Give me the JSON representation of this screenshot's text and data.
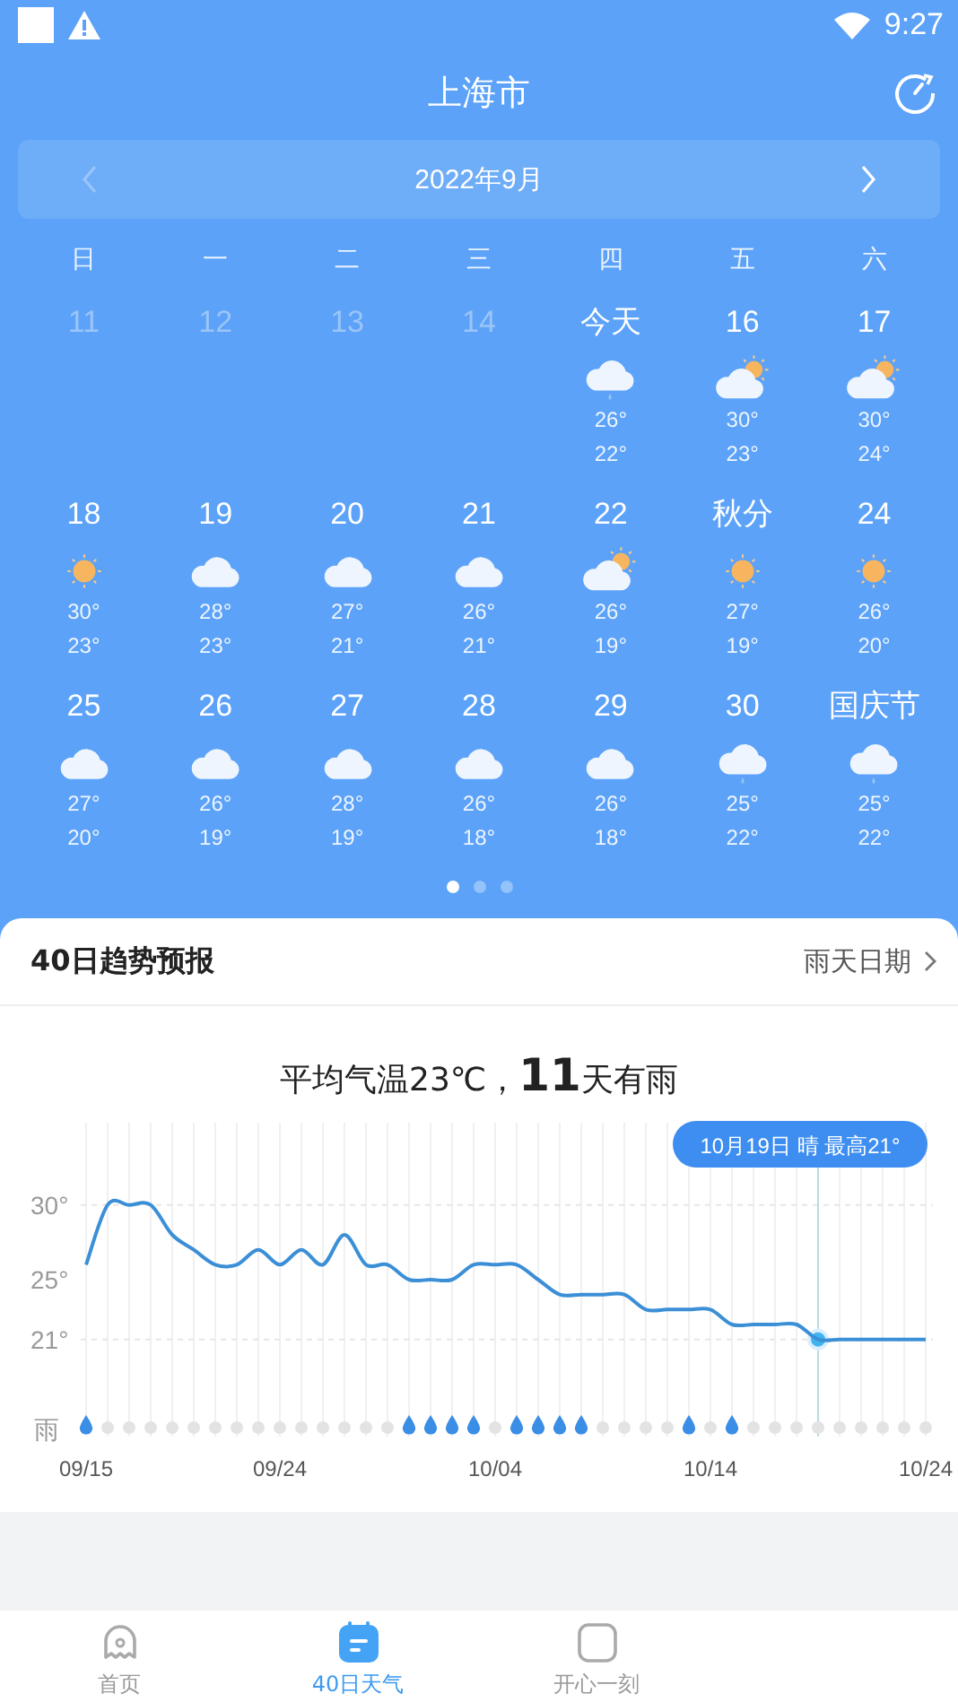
{
  "status_bar": {
    "time": "9:27"
  },
  "header": {
    "title": "上海市"
  },
  "month_nav": {
    "label": "2022年9月",
    "prev": {
      "disabled": true
    },
    "next": {
      "disabled": false
    }
  },
  "calendar": {
    "weekdays": [
      "日",
      "一",
      "二",
      "三",
      "四",
      "五",
      "六"
    ],
    "weeks": [
      [
        {
          "label": "11",
          "past": true,
          "kind": "empty"
        },
        {
          "label": "12",
          "past": true,
          "kind": "empty"
        },
        {
          "label": "13",
          "past": true,
          "kind": "empty"
        },
        {
          "label": "14",
          "past": true,
          "kind": "empty"
        },
        {
          "label": "今天",
          "past": false,
          "kind": "rain",
          "high": "26°",
          "low": "22°"
        },
        {
          "label": "16",
          "past": false,
          "kind": "partly_cloudy",
          "high": "30°",
          "low": "23°"
        },
        {
          "label": "17",
          "past": false,
          "kind": "partly_cloudy",
          "high": "30°",
          "low": "24°"
        }
      ],
      [
        {
          "label": "18",
          "past": false,
          "kind": "sunny",
          "high": "30°",
          "low": "23°"
        },
        {
          "label": "19",
          "past": false,
          "kind": "cloudy",
          "high": "28°",
          "low": "23°"
        },
        {
          "label": "20",
          "past": false,
          "kind": "cloudy",
          "high": "27°",
          "low": "21°"
        },
        {
          "label": "21",
          "past": false,
          "kind": "cloudy",
          "high": "26°",
          "low": "21°"
        },
        {
          "label": "22",
          "past": false,
          "kind": "partly_cloudy",
          "high": "26°",
          "low": "19°"
        },
        {
          "label": "秋分",
          "past": false,
          "kind": "sunny",
          "high": "27°",
          "low": "19°"
        },
        {
          "label": "24",
          "past": false,
          "kind": "sunny",
          "high": "26°",
          "low": "20°"
        }
      ],
      [
        {
          "label": "25",
          "past": false,
          "kind": "cloudy",
          "high": "27°",
          "low": "20°"
        },
        {
          "label": "26",
          "past": false,
          "kind": "cloudy",
          "high": "26°",
          "low": "19°"
        },
        {
          "label": "27",
          "past": false,
          "kind": "cloudy",
          "high": "28°",
          "low": "19°"
        },
        {
          "label": "28",
          "past": false,
          "kind": "cloudy",
          "high": "26°",
          "low": "18°"
        },
        {
          "label": "29",
          "past": false,
          "kind": "cloudy",
          "high": "26°",
          "low": "18°"
        },
        {
          "label": "30",
          "past": false,
          "kind": "rain",
          "high": "25°",
          "low": "22°"
        },
        {
          "label": "国庆节",
          "past": false,
          "kind": "rain",
          "high": "25°",
          "low": "22°"
        }
      ]
    ]
  },
  "pager": [
    {
      "selected": true
    },
    {
      "selected": false
    },
    {
      "selected": false
    }
  ],
  "trend_card": {
    "title": "40日趋势预报",
    "link": "雨天日期",
    "summary": "平均气温23℃，**11**天有雨",
    "chart": {
      "rain_label": "雨",
      "days": [
        {
          "rain": true,
          "selected": false
        },
        {
          "rain": false,
          "selected": false
        },
        {
          "rain": false,
          "selected": false
        },
        {
          "rain": false,
          "selected": false
        },
        {
          "rain": false,
          "selected": false
        },
        {
          "rain": false,
          "selected": false
        },
        {
          "rain": false,
          "selected": false
        },
        {
          "rain": false,
          "selected": false
        },
        {
          "rain": false,
          "selected": false
        },
        {
          "rain": false,
          "selected": false
        },
        {
          "rain": false,
          "selected": false
        },
        {
          "rain": false,
          "selected": false
        },
        {
          "rain": false,
          "selected": false
        },
        {
          "rain": false,
          "selected": false
        },
        {
          "rain": false,
          "selected": false
        },
        {
          "rain": true,
          "selected": false
        },
        {
          "rain": true,
          "selected": false
        },
        {
          "rain": true,
          "selected": false
        },
        {
          "rain": true,
          "selected": false
        },
        {
          "rain": false,
          "selected": false
        },
        {
          "rain": true,
          "selected": false
        },
        {
          "rain": true,
          "selected": false
        },
        {
          "rain": true,
          "selected": false
        },
        {
          "rain": true,
          "selected": false
        },
        {
          "rain": false,
          "selected": false
        },
        {
          "rain": false,
          "selected": false
        },
        {
          "rain": false,
          "selected": false
        },
        {
          "rain": false,
          "selected": false
        },
        {
          "rain": true,
          "selected": false
        },
        {
          "rain": false,
          "selected": false
        },
        {
          "rain": true,
          "selected": false
        },
        {
          "rain": false,
          "selected": false
        },
        {
          "rain": false,
          "selected": false
        },
        {
          "rain": false,
          "selected": false
        },
        {
          "rain": false,
          "selected": true
        },
        {
          "rain": false,
          "selected": false
        },
        {
          "rain": false,
          "selected": false
        },
        {
          "rain": false,
          "selected": false
        },
        {
          "rain": false,
          "selected": false
        },
        {
          "rain": false,
          "selected": false
        }
      ],
      "chart_data": {
        "type": "line",
        "grid": true,
        "ylim": [
          14.5,
          35.5
        ],
        "categories": [
          "09/15",
          null,
          null,
          null,
          null,
          null,
          null,
          null,
          null,
          "09/24",
          null,
          null,
          null,
          null,
          null,
          null,
          null,
          null,
          null,
          "10/04",
          null,
          null,
          null,
          null,
          null,
          null,
          null,
          null,
          null,
          "10/14",
          null,
          null,
          null,
          null,
          null,
          null,
          null,
          null,
          null,
          "10/24"
        ],
        "series": [
          {
            "color": "#3b8fd6",
            "values": [
              26,
              30,
              30,
              30,
              28,
              27,
              26,
              26,
              27,
              26,
              27,
              26,
              28,
              26,
              26,
              25,
              25,
              25,
              26,
              26,
              26,
              25,
              24,
              24,
              24,
              24,
              23,
              23,
              23,
              23,
              22,
              22,
              22,
              22,
              21,
              21,
              21,
              21,
              21,
              21
            ]
          }
        ],
        "yticks": [
          {
            "value": 30,
            "label": "30°"
          },
          {
            "value": 25,
            "label": "25°"
          },
          {
            "value": 21,
            "label": "21°"
          }
        ],
        "annotations": [
          "10月19日 晴 最高21°"
        ]
      }
    }
  },
  "bottom_nav": [
    {
      "label": "首页",
      "kind": "ghost",
      "selected": false
    },
    {
      "label": "40日天气",
      "kind": "calendar",
      "selected": true
    },
    {
      "label": "开心一刻",
      "kind": "square",
      "selected": false
    }
  ]
}
